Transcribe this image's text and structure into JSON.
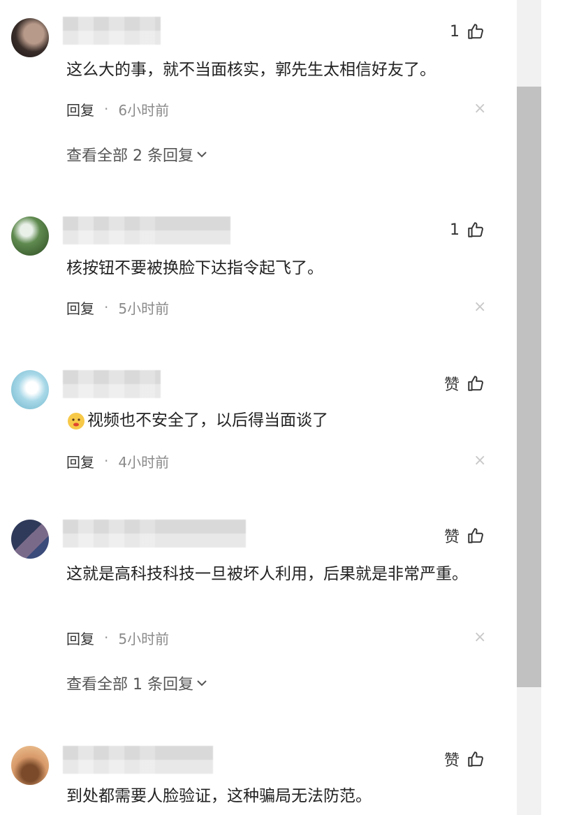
{
  "comments": [
    {
      "likes": "1",
      "text": "这么大的事，就不当面核实，郭先生太相信好友了。",
      "reply_label": "回复",
      "separator": "·",
      "time": "6小时前",
      "close": "×",
      "view_replies": "查看全部 2 条回复"
    },
    {
      "username_partial": "…，…8…6606",
      "likes": "1",
      "text": "核按钮不要被换脸下达指令起飞了。",
      "reply_label": "回复",
      "separator": "·",
      "time": "5小时前",
      "close": "×"
    },
    {
      "likes": "赞",
      "text": "视频也不安全了，以后得当面谈了",
      "reply_label": "回复",
      "separator": "·",
      "time": "4小时前",
      "close": "×"
    },
    {
      "likes": "赞",
      "text": "这就是高科技科技一旦被坏人利用，后果就是非常严重。",
      "reply_label": "回复",
      "separator": "·",
      "time": "5小时前",
      "close": "×",
      "view_replies": "查看全部 1 条回复"
    },
    {
      "likes": "赞",
      "text": "到处都需要人脸验证，这种骗局无法防范。"
    }
  ],
  "icons": {
    "like": "thumbs-up-icon",
    "close": "close-icon",
    "expand": "chevron-down-icon",
    "emoji": "face-emoji-icon"
  },
  "colors": {
    "text": "#222222",
    "meta": "#8a8a8a",
    "close": "#c8c8c8",
    "scrollbar_track": "#f1f1f1",
    "scrollbar_thumb": "#c1c1c1"
  }
}
